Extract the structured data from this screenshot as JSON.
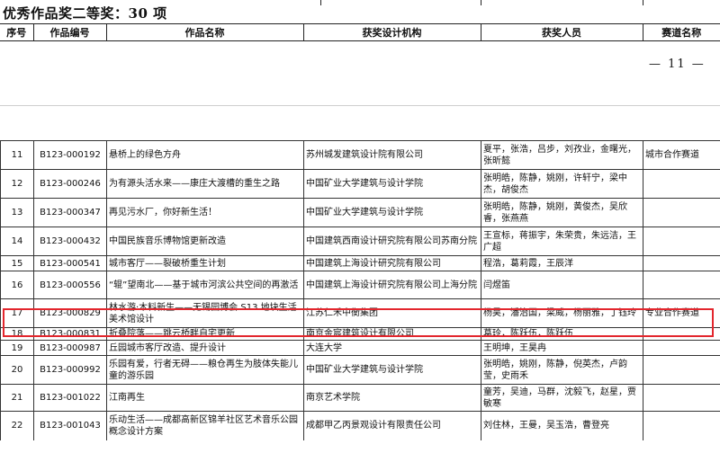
{
  "heading": {
    "title": "优秀作品奖二等奖：30 项"
  },
  "columns": [
    "序号",
    "作品编号",
    "作品名称",
    "获奖设计机构",
    "获奖人员",
    "赛道名称"
  ],
  "page_number": "— 11 —",
  "rows": [
    {
      "no": "11",
      "id": "B123-000192",
      "name": "悬桥上的绿色方舟",
      "org": "苏州城发建筑设计院有限公司",
      "people": "夏平，张浩，吕步，刘孜业，金曙光，张昕懿",
      "track": "城市合作赛道"
    },
    {
      "no": "12",
      "id": "B123-000246",
      "name": "为有源头活水来——康庄大渡槽的重生之路",
      "org": "中国矿业大学建筑与设计学院",
      "people": "张明皓，陈静，姚刚，许轩宁，梁中杰，胡俊杰",
      "track": ""
    },
    {
      "no": "13",
      "id": "B123-000347",
      "name": "再见污水厂，你好新生活！",
      "org": "中国矿业大学建筑与设计学院",
      "people": "张明皓，陈静，姚刚，黄俊杰，吴欣睿，张燕燕",
      "track": ""
    },
    {
      "no": "14",
      "id": "B123-000432",
      "name": "中国民族音乐博物馆更新改造",
      "org": "中国建筑西南设计研究院有限公司苏南分院",
      "people": "王宣标，蒋振宇，朱荣贵，朱远洁，王广超",
      "track": ""
    },
    {
      "no": "15",
      "id": "B123-000541",
      "name": "城市客厅——裂破桥重生计划",
      "org": "中国建筑上海设计研究院有限公司",
      "people": "程浩，葛莉霞，王辰洋",
      "track": ""
    },
    {
      "no": "16",
      "id": "B123-000556",
      "name": "“辊”望南北——基于城市河滨公共空间的再激活",
      "org": "中国建筑上海设计研究院有限公司上海分院",
      "people": "闫煜笛",
      "track": ""
    },
    {
      "no": "17",
      "id": "B123-000829",
      "name": "林水游·木料新生——无锡园博会 S13 地块生活美术馆设计",
      "org": "江苏仁禾中衡集团",
      "people": "杨昊，潘治国，梁威，杨丽雅，丁钰玲",
      "track": "专业合作赛道"
    },
    {
      "no": "18",
      "id": "B123-000831",
      "name": "折叠院落——跳云桥畔自宅更新",
      "org": "南京金宸建筑设计有限公司",
      "people": "葛玲，陈跃伍，陈跃伍",
      "track": ""
    },
    {
      "no": "19",
      "id": "B123-000987",
      "name": "丘园城市客厅改造、提升设计",
      "org": "大连大学",
      "people": "王明坤，王昊冉",
      "track": ""
    },
    {
      "no": "20",
      "id": "B123-000992",
      "name": "乐园有爱，行者无碍——粮仓再生为肢体失能儿童的游乐园",
      "org": "中国矿业大学建筑与设计学院",
      "people": "张明皓，姚刚，陈静，倪英杰，卢韵莹，史雨禾",
      "track": ""
    },
    {
      "no": "21",
      "id": "B123-001022",
      "name": "江南再生",
      "org": "南京艺术学院",
      "people": "童芳，吴迪，马群，沈毅飞，赵星，贾敏寒",
      "track": ""
    },
    {
      "no": "22",
      "id": "B123-001043",
      "name": "乐动生活——成都高新区锦羊社区艺术音乐公园概念设计方案",
      "org": "成都甲乙丙景观设计有限责任公司",
      "people": "刘住林，王曼，吴玉浩，曹登亮",
      "track": ""
    }
  ]
}
